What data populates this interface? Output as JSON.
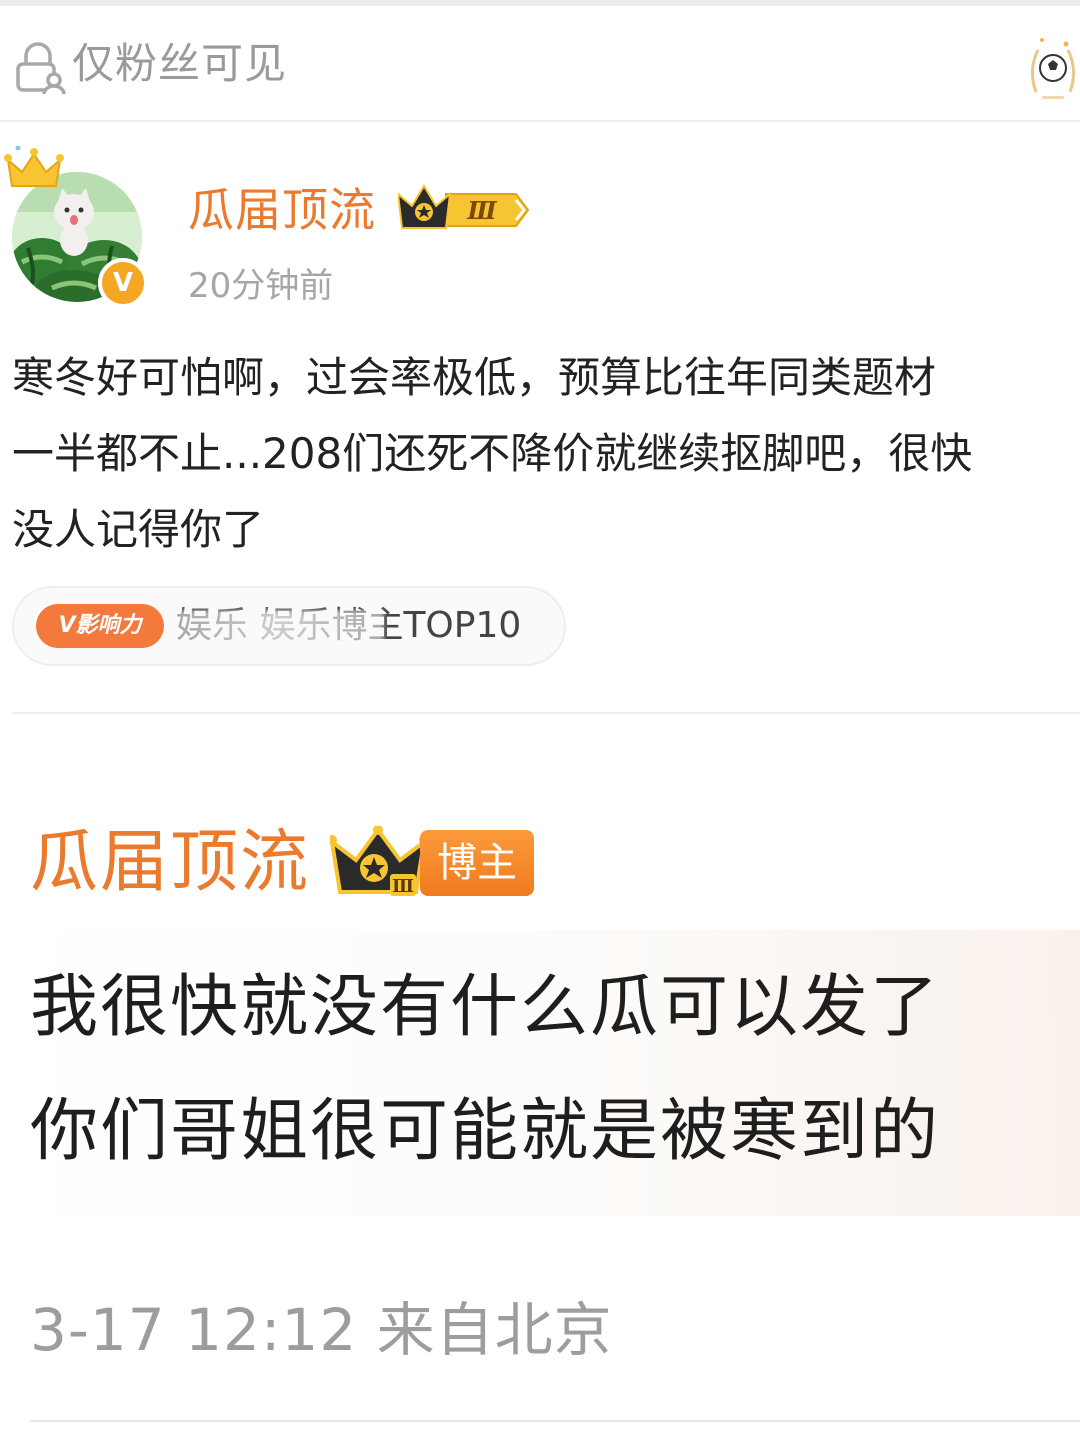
{
  "header": {
    "visibility_label": "仅粉丝可见",
    "lock_icon": "lock-person-icon",
    "medal_icon": "football-medal-icon"
  },
  "post": {
    "author": {
      "name": "瓜届顶流",
      "level": "Ⅲ",
      "verified_mark": "V",
      "avatar_icon": "avatar-cat-watermelon",
      "crown_icon": "crown-icon"
    },
    "time": "20分钟前",
    "text_lines": [
      "寒冬好可怕啊，过会率极低，预算比往年同类题材",
      "一半都不止...208们还死不降价就继续抠脚吧，很快",
      "没人记得你了"
    ],
    "influence": {
      "badge": "V影响力",
      "text": "娱乐 娱乐博主TOP10"
    }
  },
  "zoom": {
    "name": "瓜届顶流",
    "badge_level": "Ⅲ",
    "badge_label": "博主",
    "quote_lines": [
      "我很快就没有什么瓜可以发了",
      "你们哥姐很可能就是被寒到的"
    ],
    "meta": "3-17 12:12  来自北京"
  },
  "colors": {
    "accent_orange": "#e97a2e",
    "badge_orange": "#f37a3c",
    "muted_gray": "#9d9d9d"
  }
}
